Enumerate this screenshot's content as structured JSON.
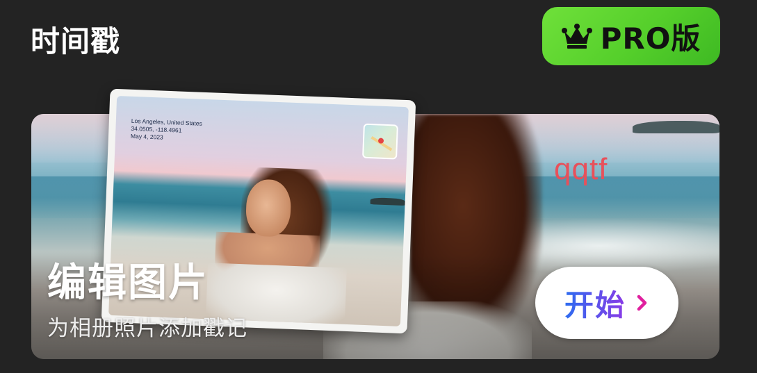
{
  "header": {
    "title": "时间戳",
    "pro_button_label": "PRO版",
    "pro_icon": "crown-icon"
  },
  "banner": {
    "title": "编辑图片",
    "subtitle": "为相册照片添加戳记",
    "watermark": "qqtf",
    "start_button_label": "开始",
    "start_icon": "chevron-right-icon",
    "photo_stamp": {
      "location": "Los Angeles, United States",
      "coords": "34.0505, -118.4961",
      "date": "May 4, 2023"
    },
    "map_icon": "map-thumbnail-icon"
  },
  "colors": {
    "background": "#232323",
    "pro_green": "#55cf2b",
    "watermark_red": "#e8505a",
    "start_gradient_from": "#2c6cf0",
    "start_gradient_to": "#8a3ae6",
    "chevron_magenta": "#e0209e"
  }
}
